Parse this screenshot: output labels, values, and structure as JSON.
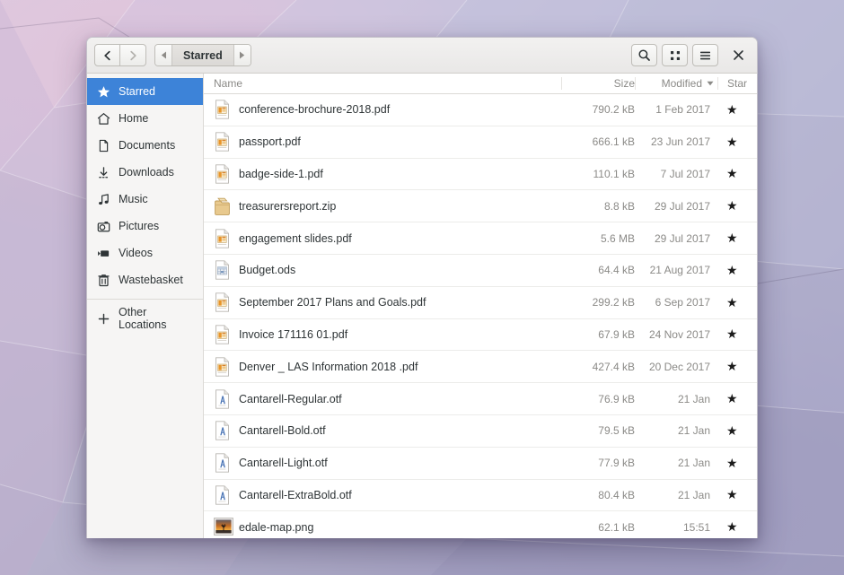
{
  "window": {
    "title": "Starred",
    "nav": {
      "back": "back-arrow",
      "forward": "forward-arrow"
    },
    "breadcrumb": {
      "prev_arrow": "◀",
      "label": "Starred",
      "next_arrow": "▶"
    },
    "actions": {
      "search": "search-icon",
      "grid_view": "grid-view-icon",
      "list_menu": "hamburger-menu-icon",
      "close": "✕"
    }
  },
  "sidebar": {
    "items": [
      {
        "label": "Starred",
        "icon": "star-icon",
        "selected": true
      },
      {
        "label": "Home",
        "icon": "home-icon",
        "selected": false
      },
      {
        "label": "Documents",
        "icon": "document-icon",
        "selected": false
      },
      {
        "label": "Downloads",
        "icon": "download-icon",
        "selected": false
      },
      {
        "label": "Music",
        "icon": "music-icon",
        "selected": false
      },
      {
        "label": "Pictures",
        "icon": "camera-icon",
        "selected": false
      },
      {
        "label": "Videos",
        "icon": "video-icon",
        "selected": false
      },
      {
        "label": "Wastebasket",
        "icon": "trash-icon",
        "selected": false
      }
    ],
    "other_locations": {
      "label": "Other Locations",
      "icon": "plus-icon"
    }
  },
  "filelist": {
    "columns": {
      "name": "Name",
      "size": "Size",
      "modified": "Modified",
      "sort_indicator": "▼",
      "star": "Star"
    },
    "rows": [
      {
        "name": "conference-brochure-2018.pdf",
        "size": "790.2 kB",
        "modified": "1 Feb 2017",
        "starred": "★",
        "icon": "pdf"
      },
      {
        "name": "passport.pdf",
        "size": "666.1 kB",
        "modified": "23 Jun 2017",
        "starred": "★",
        "icon": "pdf"
      },
      {
        "name": "badge-side-1.pdf",
        "size": "110.1 kB",
        "modified": "7 Jul 2017",
        "starred": "★",
        "icon": "pdf"
      },
      {
        "name": "treasurersreport.zip",
        "size": "8.8 kB",
        "modified": "29 Jul 2017",
        "starred": "★",
        "icon": "zip"
      },
      {
        "name": "engagement slides.pdf",
        "size": "5.6 MB",
        "modified": "29 Jul 2017",
        "starred": "★",
        "icon": "pdf"
      },
      {
        "name": "Budget.ods",
        "size": "64.4 kB",
        "modified": "21 Aug 2017",
        "starred": "★",
        "icon": "spreadsheet"
      },
      {
        "name": "September 2017 Plans and Goals.pdf",
        "size": "299.2 kB",
        "modified": "6 Sep 2017",
        "starred": "★",
        "icon": "pdf"
      },
      {
        "name": "Invoice 171116  01.pdf",
        "size": "67.9 kB",
        "modified": "24 Nov 2017",
        "starred": "★",
        "icon": "pdf"
      },
      {
        "name": "Denver _ LAS Information 2018 .pdf",
        "size": "427.4 kB",
        "modified": "20 Dec 2017",
        "starred": "★",
        "icon": "pdf"
      },
      {
        "name": "Cantarell-Regular.otf",
        "size": "76.9 kB",
        "modified": "21 Jan",
        "starred": "★",
        "icon": "font"
      },
      {
        "name": "Cantarell-Bold.otf",
        "size": "79.5 kB",
        "modified": "21 Jan",
        "starred": "★",
        "icon": "font"
      },
      {
        "name": "Cantarell-Light.otf",
        "size": "77.9 kB",
        "modified": "21 Jan",
        "starred": "★",
        "icon": "font"
      },
      {
        "name": "Cantarell-ExtraBold.otf",
        "size": "80.4 kB",
        "modified": "21 Jan",
        "starred": "★",
        "icon": "font"
      },
      {
        "name": "edale-map.png",
        "size": "62.1 kB",
        "modified": "15:51",
        "starred": "★",
        "icon": "image"
      }
    ]
  },
  "colors": {
    "selection": "#3d83d8",
    "sidebar_bg": "#f6f5f4",
    "header_bg": "#f2f1f0",
    "text": "#2e3436",
    "muted_text": "#8b8a87"
  }
}
